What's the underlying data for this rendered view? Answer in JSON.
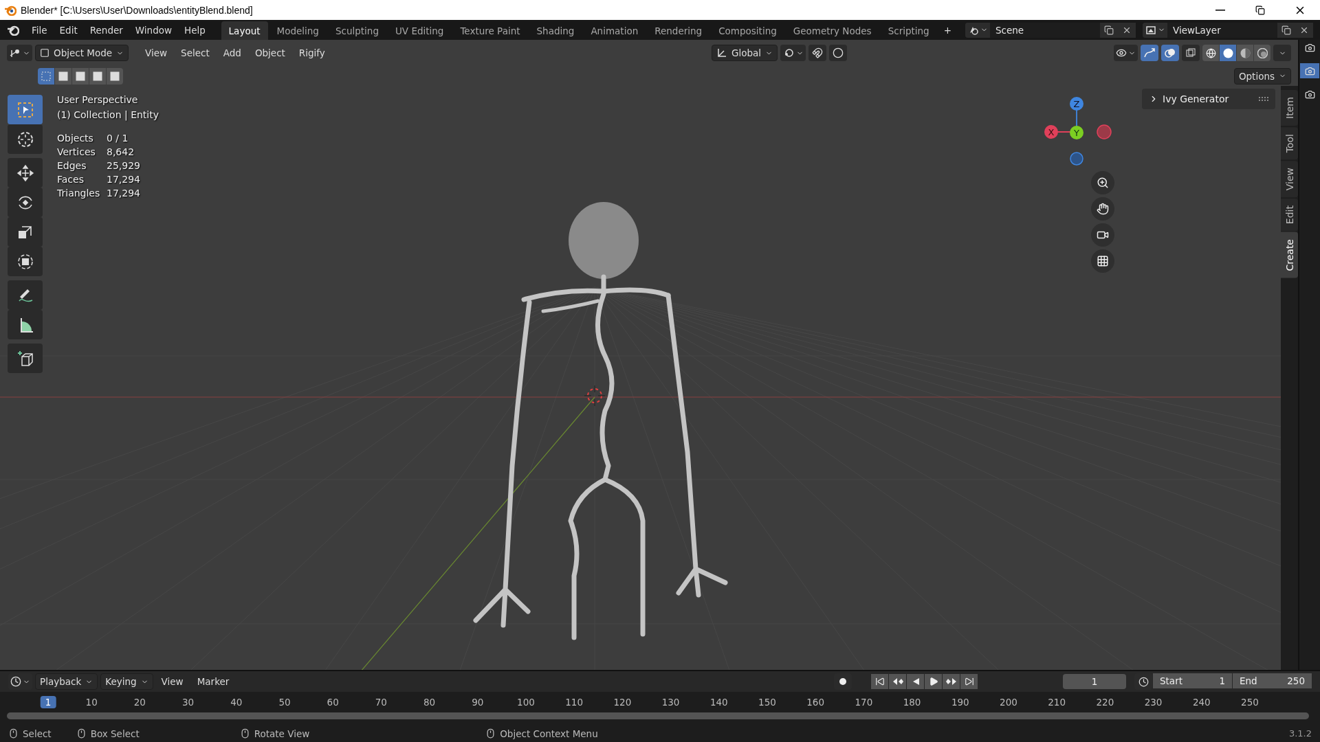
{
  "window": {
    "title": "Blender* [C:\\Users\\User\\Downloads\\entityBlend.blend]"
  },
  "menus": [
    "File",
    "Edit",
    "Render",
    "Window",
    "Help"
  ],
  "workspaces": [
    {
      "label": "Layout",
      "selected": true
    },
    {
      "label": "Modeling",
      "selected": false
    },
    {
      "label": "Sculpting",
      "selected": false
    },
    {
      "label": "UV Editing",
      "selected": false
    },
    {
      "label": "Texture Paint",
      "selected": false
    },
    {
      "label": "Shading",
      "selected": false
    },
    {
      "label": "Animation",
      "selected": false
    },
    {
      "label": "Rendering",
      "selected": false
    },
    {
      "label": "Compositing",
      "selected": false
    },
    {
      "label": "Geometry Nodes",
      "selected": false
    },
    {
      "label": "Scripting",
      "selected": false
    }
  ],
  "add_workspace": "+",
  "scene": {
    "value": "Scene"
  },
  "view_layer": {
    "value": "ViewLayer"
  },
  "viewport_header": {
    "mode": "Object Mode",
    "menus": [
      "View",
      "Select",
      "Add",
      "Object",
      "Rigify"
    ],
    "orientation": "Global",
    "toggles": [
      {
        "kind": "snap",
        "on": false
      },
      {
        "kind": "proportional",
        "on": false
      },
      {
        "kind": "gizmos",
        "on": true
      },
      {
        "kind": "overlays",
        "on": true
      },
      {
        "kind": "xray",
        "on": false
      }
    ],
    "shading": [
      {
        "kind": "wireframe",
        "selected": false
      },
      {
        "kind": "solid",
        "selected": true
      },
      {
        "kind": "material",
        "selected": false
      },
      {
        "kind": "rendered",
        "selected": false
      }
    ],
    "select_modes": [
      {
        "selected": true
      },
      {
        "selected": false
      },
      {
        "selected": false
      },
      {
        "selected": false
      },
      {
        "selected": false
      }
    ],
    "options": "Options"
  },
  "tools": [
    {
      "kind": "select",
      "selected": true
    },
    {
      "kind": "cursor",
      "selected": false
    },
    {
      "kind": "move",
      "selected": false
    },
    {
      "kind": "rotate",
      "selected": false
    },
    {
      "kind": "scale",
      "selected": false
    },
    {
      "kind": "transform",
      "selected": false
    },
    {
      "kind": "annotate",
      "selected": false
    },
    {
      "kind": "measure",
      "selected": false
    },
    {
      "kind": "add-cube",
      "selected": false
    }
  ],
  "overlay": {
    "view": "User Perspective",
    "collection": "(1) Collection | Entity",
    "stats": [
      {
        "label": "Objects",
        "value": "0 / 1"
      },
      {
        "label": "Vertices",
        "value": "8,642"
      },
      {
        "label": "Edges",
        "value": "25,929"
      },
      {
        "label": "Faces",
        "value": "17,294"
      },
      {
        "label": "Triangles",
        "value": "17,294"
      }
    ]
  },
  "gizmo": {
    "x": "X",
    "y": "Y",
    "z": "Z"
  },
  "sidebar": {
    "panel": "Ivy Generator",
    "tabs": [
      {
        "label": "Item",
        "selected": false
      },
      {
        "label": "Tool",
        "selected": false
      },
      {
        "label": "View",
        "selected": false
      },
      {
        "label": "Edit",
        "selected": false
      },
      {
        "label": "Create",
        "selected": true
      }
    ]
  },
  "outliner_strip": [
    {
      "selected": false
    },
    {
      "selected": true
    },
    {
      "selected": false
    }
  ],
  "timeline": {
    "menus": [
      "Playback",
      "Keying",
      "View",
      "Marker"
    ],
    "current_frame": "1",
    "start_label": "Start",
    "start": "1",
    "end_label": "End",
    "end": "250",
    "ruler": [
      "1",
      "10",
      "20",
      "30",
      "40",
      "50",
      "60",
      "70",
      "80",
      "90",
      "100",
      "110",
      "120",
      "130",
      "140",
      "150",
      "160",
      "170",
      "180",
      "190",
      "200",
      "210",
      "220",
      "230",
      "240",
      "250"
    ]
  },
  "status_bar": {
    "items": [
      "Select",
      "Box Select",
      "Rotate View",
      "Object Context Menu"
    ],
    "version": "3.1.2"
  }
}
